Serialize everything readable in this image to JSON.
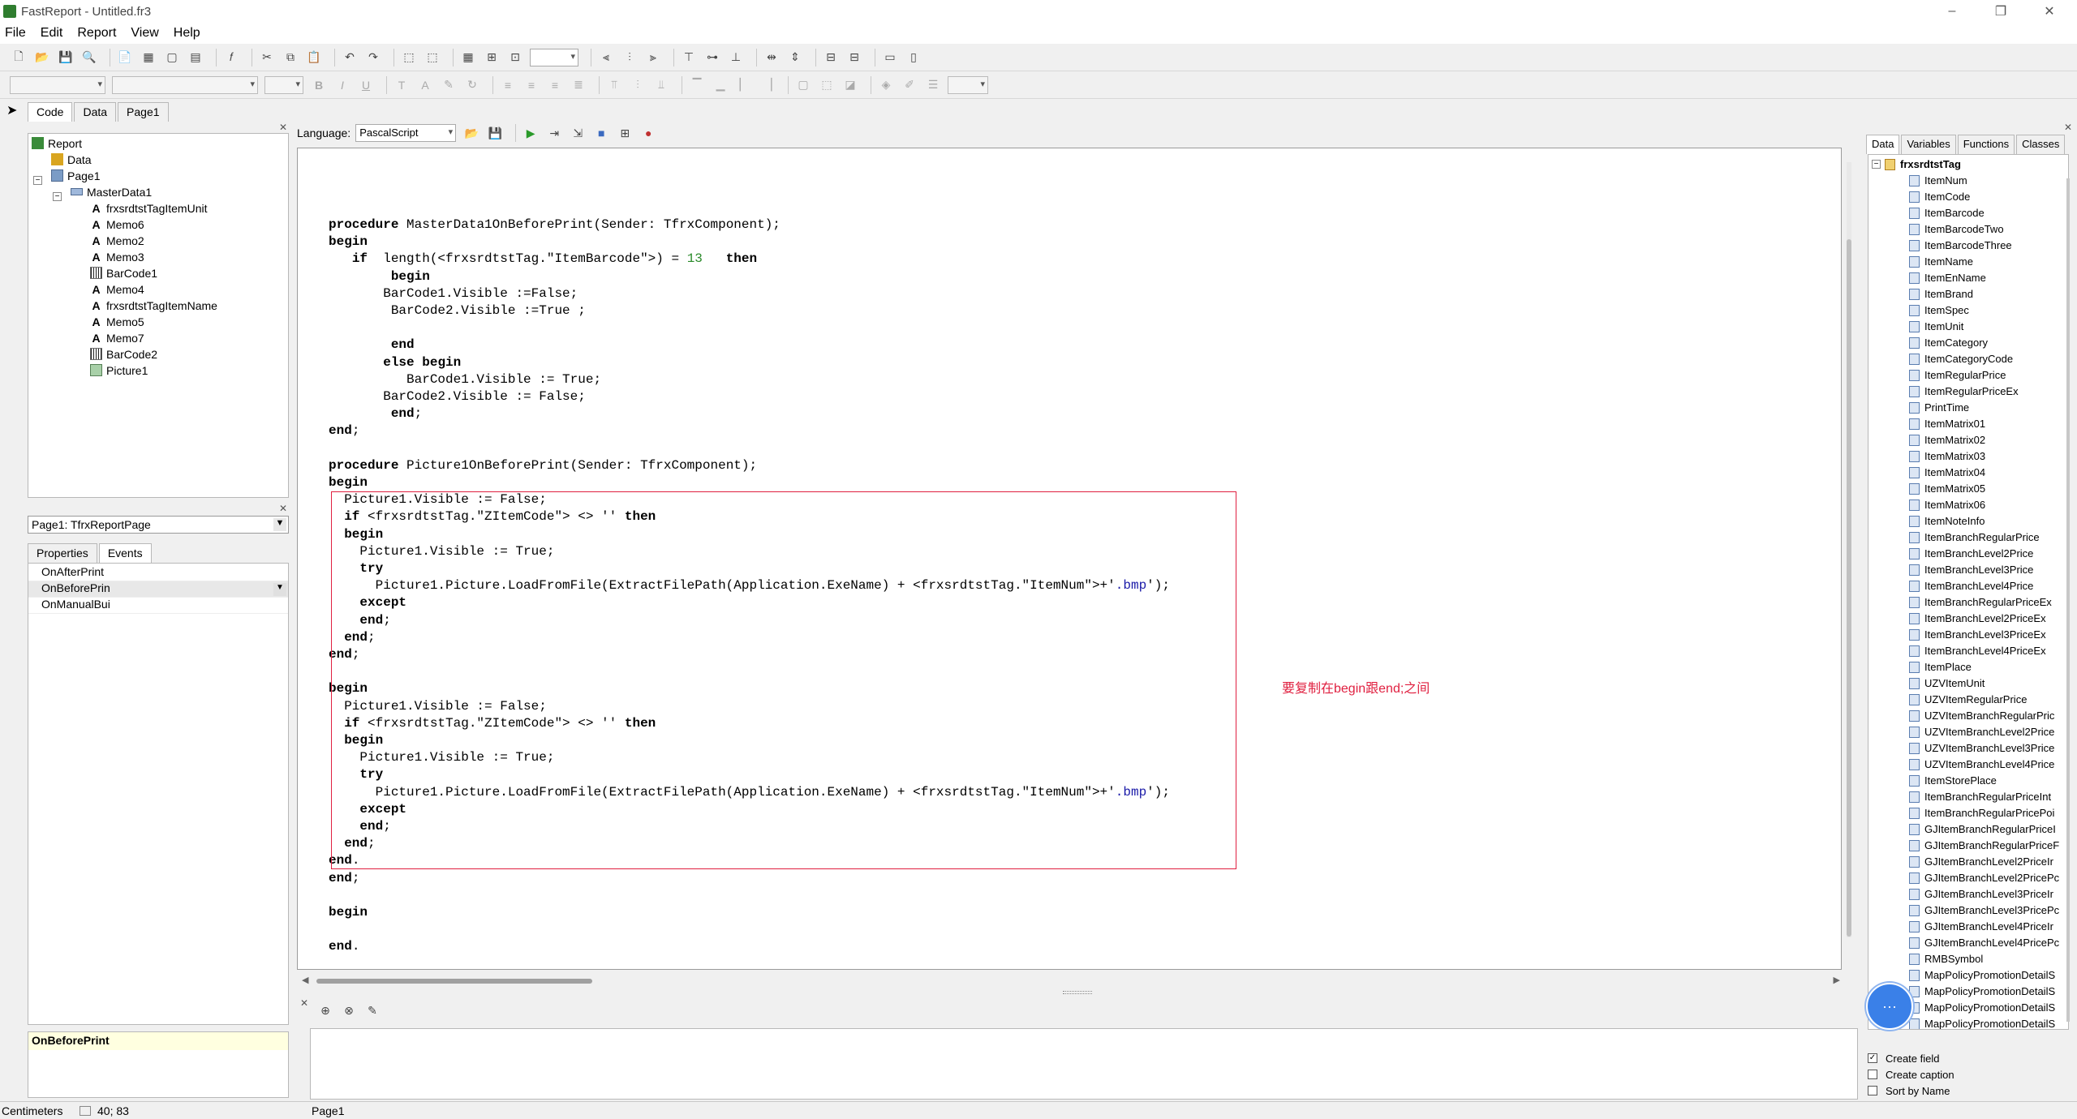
{
  "window": {
    "title": "FastReport - Untitled.fr3",
    "minimize": "–",
    "restore": "❐",
    "close": "✕"
  },
  "menu": [
    "File",
    "Edit",
    "Report",
    "View",
    "Help"
  ],
  "toolbar_row2": {
    "zoom_value": ""
  },
  "left_tabs": [
    "Code",
    "Data",
    "Page1"
  ],
  "tree": [
    {
      "label": "Report",
      "icon": "report-icon"
    },
    {
      "label": "Data",
      "icon": "data-icon"
    },
    {
      "label": "Page1",
      "icon": "page-icon"
    },
    {
      "label": "MasterData1",
      "icon": "band-icon"
    },
    {
      "label": "frxsrdtstTagItemUnit",
      "icon": "text-icon"
    },
    {
      "label": "Memo6",
      "icon": "text-icon"
    },
    {
      "label": "Memo2",
      "icon": "text-icon"
    },
    {
      "label": "Memo3",
      "icon": "text-icon"
    },
    {
      "label": "BarCode1",
      "icon": "barcode-icon"
    },
    {
      "label": "Memo4",
      "icon": "text-icon"
    },
    {
      "label": "frxsrdtstTagItemName",
      "icon": "text-icon"
    },
    {
      "label": "Memo5",
      "icon": "text-icon"
    },
    {
      "label": "Memo7",
      "icon": "text-icon"
    },
    {
      "label": "BarCode2",
      "icon": "barcode-icon"
    },
    {
      "label": "Picture1",
      "icon": "picture-icon"
    }
  ],
  "object_combo": "Page1: TfrxReportPage",
  "inspector_tabs": [
    "Properties",
    "Events"
  ],
  "events": [
    "OnAfterPrint",
    "OnBeforePrin",
    "OnManualBui"
  ],
  "event_description": "OnBeforePrint",
  "script": {
    "language_label": "Language:",
    "language": "PascalScript",
    "annotation": "要复制在begin跟end;之间",
    "lines": [
      "procedure MasterData1OnBeforePrint(Sender: TfrxComponent);",
      "begin",
      "   if  length(<frxsrdtstTag.\"ItemBarcode\">) = 13   then",
      "        begin",
      "       BarCode1.Visible :=False;",
      "        BarCode2.Visible :=True ;",
      "",
      "        end",
      "       else begin",
      "          BarCode1.Visible := True;",
      "       BarCode2.Visible := False;",
      "        end;",
      "end;",
      "",
      "procedure Picture1OnBeforePrint(Sender: TfrxComponent);",
      "begin",
      "  Picture1.Visible := False;",
      "  if <frxsrdtstTag.\"ZItemCode\"> <> '' then",
      "  begin",
      "    Picture1.Visible := True;",
      "    try",
      "      Picture1.Picture.LoadFromFile(ExtractFilePath(Application.ExeName) + <frxsrdtstTag.\"ItemNum\">+'.bmp');",
      "    except",
      "    end;",
      "  end;",
      "end;",
      "",
      "begin",
      "  Picture1.Visible := False;",
      "  if <frxsrdtstTag.\"ZItemCode\"> <> '' then",
      "  begin",
      "    Picture1.Visible := True;",
      "    try",
      "      Picture1.Picture.LoadFromFile(ExtractFilePath(Application.ExeName) + <frxsrdtstTag.\"ItemNum\">+'.bmp');",
      "    except",
      "    end;",
      "  end;",
      "end.",
      "end;",
      "",
      "begin",
      "",
      "end."
    ]
  },
  "right_tabs": [
    "Data",
    "Variables",
    "Functions",
    "Classes"
  ],
  "dataset": "frxsrdtstTag",
  "fields": [
    "ItemNum",
    "ItemCode",
    "ItemBarcode",
    "ItemBarcodeTwo",
    "ItemBarcodeThree",
    "ItemName",
    "ItemEnName",
    "ItemBrand",
    "ItemSpec",
    "ItemUnit",
    "ItemCategory",
    "ItemCategoryCode",
    "ItemRegularPrice",
    "ItemRegularPriceEx",
    "PrintTime",
    "ItemMatrix01",
    "ItemMatrix02",
    "ItemMatrix03",
    "ItemMatrix04",
    "ItemMatrix05",
    "ItemMatrix06",
    "ItemNoteInfo",
    "ItemBranchRegularPrice",
    "ItemBranchLevel2Price",
    "ItemBranchLevel3Price",
    "ItemBranchLevel4Price",
    "ItemBranchRegularPriceEx",
    "ItemBranchLevel2PriceEx",
    "ItemBranchLevel3PriceEx",
    "ItemBranchLevel4PriceEx",
    "ItemPlace",
    "UZVItemUnit",
    "UZVItemRegularPrice",
    "UZVItemBranchRegularPric",
    "UZVItemBranchLevel2Price",
    "UZVItemBranchLevel3Price",
    "UZVItemBranchLevel4Price",
    "ItemStorePlace",
    "ItemBranchRegularPriceInt",
    "ItemBranchRegularPricePoi",
    "GJItemBranchRegularPriceI",
    "GJItemBranchRegularPriceF",
    "GJItemBranchLevel2PriceIr",
    "GJItemBranchLevel2PricePc",
    "GJItemBranchLevel3PriceIr",
    "GJItemBranchLevel3PricePc",
    "GJItemBranchLevel4PriceIr",
    "GJItemBranchLevel4PricePc",
    "RMBSymbol",
    "MapPolicyPromotionDetailS",
    "MapPolicyPromotionDetailS",
    "MapPolicyPromotionDetailS",
    "MapPolicyPromotionDetailS"
  ],
  "options": [
    {
      "label": "Create field",
      "checked": true
    },
    {
      "label": "Create caption",
      "checked": false
    },
    {
      "label": "Sort by Name",
      "checked": false
    }
  ],
  "status": {
    "units": "Centimeters",
    "coords": "40; 83",
    "page": "Page1"
  }
}
